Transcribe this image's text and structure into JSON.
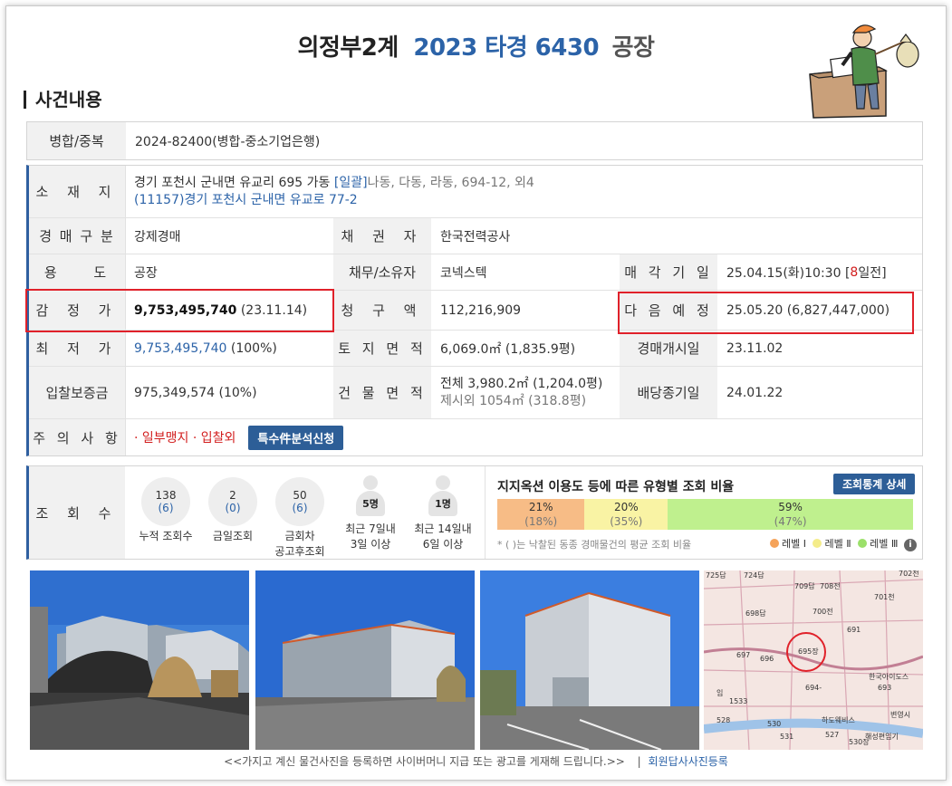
{
  "header": {
    "court": "의정부2계",
    "case_no": "2023 타경 6430",
    "kind": "공장"
  },
  "section_title": "사건내용",
  "merge": {
    "label": "병합/중복",
    "value": "2024-82400(병합-중소기업은행)"
  },
  "details": {
    "location": {
      "label": "소 재 지",
      "line1": "경기 포천시 군내면 유교리 695 가동",
      "line1_bracket": "[일괄]",
      "line1_extra": "나동, 다동, 라동, 694-12, 외4",
      "line2": "(11157)경기 포천시  군내면 유교로  77-2"
    },
    "auction_type": {
      "label": "경 매 구 분",
      "value": "강제경매"
    },
    "creditor": {
      "label": "채 권 자",
      "value": "한국전력공사"
    },
    "usage": {
      "label": "용 도",
      "value": "공장"
    },
    "debtor": {
      "label": "채무/소유자",
      "value": "코넥스텍"
    },
    "sale_date": {
      "label": "매 각 기 일",
      "value_pre": "25.04.15(화)10:30 [",
      "days": "8",
      "value_post": "일전]"
    },
    "appraisal": {
      "label": "감 정 가",
      "value": "9,753,495,740",
      "date": "(23.11.14)"
    },
    "claim": {
      "label": "청 구 액",
      "value": "112,216,909"
    },
    "next_schedule": {
      "label": "다 음 예 정",
      "value": "25.05.20 (6,827,447,000)"
    },
    "minimum": {
      "label": "최 저 가",
      "value": "9,753,495,740",
      "pct": "(100%)"
    },
    "land_area": {
      "label": "토 지 면 적",
      "value": "6,069.0㎡ (1,835.9평)"
    },
    "auction_start": {
      "label": "경매개시일",
      "value": "23.11.02"
    },
    "deposit": {
      "label": "입찰보증금",
      "value": "975,349,574 (10%)"
    },
    "building_area": {
      "label": "건 물 면 적",
      "line1": "전체 3,980.2㎡ (1,204.0평)",
      "line2": "제시외 1054㎡ (318.8평)"
    },
    "dividend_end": {
      "label": "배당종기일",
      "value": "24.01.22"
    },
    "notes": {
      "label": "주 의 사 항",
      "value": "· 일부맹지 · 입찰외",
      "button": "특수件분석신청"
    }
  },
  "views": {
    "label": "조 회 수",
    "stats": [
      {
        "num": "138",
        "sub": "(6)",
        "cap1": "누적 조회수",
        "cap2": ""
      },
      {
        "num": "2",
        "sub": "(0)",
        "cap1": "금일조회",
        "cap2": ""
      },
      {
        "num": "50",
        "sub": "(6)",
        "cap1": "금회차",
        "cap2": "공고후조회"
      }
    ],
    "persons": [
      {
        "count": "5명",
        "cap1": "최근 7일내",
        "cap2": "3일 이상"
      },
      {
        "count": "1명",
        "cap1": "최근 14일내",
        "cap2": "6일 이상"
      }
    ],
    "ratio_title": "지지옥션 이용도 등에 따른 유형별 조회 비율",
    "ratio_button": "조회통계 상세",
    "bars": [
      {
        "pct": "21%",
        "avg": "(18%)",
        "share": 21,
        "color": "#f7bc86"
      },
      {
        "pct": "20%",
        "avg": "(35%)",
        "share": 20,
        "color": "#f9f3a4"
      },
      {
        "pct": "59%",
        "avg": "(47%)",
        "share": 59,
        "color": "#bff08e"
      }
    ],
    "ratio_note": "* ( )는 낙찰된 동종 경매물건의 평균 조회 비율",
    "legend": [
      {
        "label": "레벨 Ⅰ",
        "color": "#f5a35a"
      },
      {
        "label": "레벨 Ⅱ",
        "color": "#f4ec8a"
      },
      {
        "label": "레벨 Ⅲ",
        "color": "#9be06a"
      }
    ],
    "info_icon": "info-icon"
  },
  "map": {
    "labels": [
      "725답",
      "724답",
      "709답",
      "708전",
      "702전",
      "698답",
      "701천",
      "700전",
      "697",
      "695장",
      "691",
      "696",
      "693",
      "임",
      "694-",
      "한국아이도스",
      "1533",
      "527",
      "530",
      "530장",
      "변영시",
      "528",
      "531",
      "하도웨비스",
      "해성편임기"
    ]
  },
  "footer": {
    "note": "<<가지고 계신 물건사진을 등록하면 사이버머니 지급 또는 광고를 게재해 드립니다.>>",
    "sep": "|",
    "link": "회원답사사진등록"
  }
}
